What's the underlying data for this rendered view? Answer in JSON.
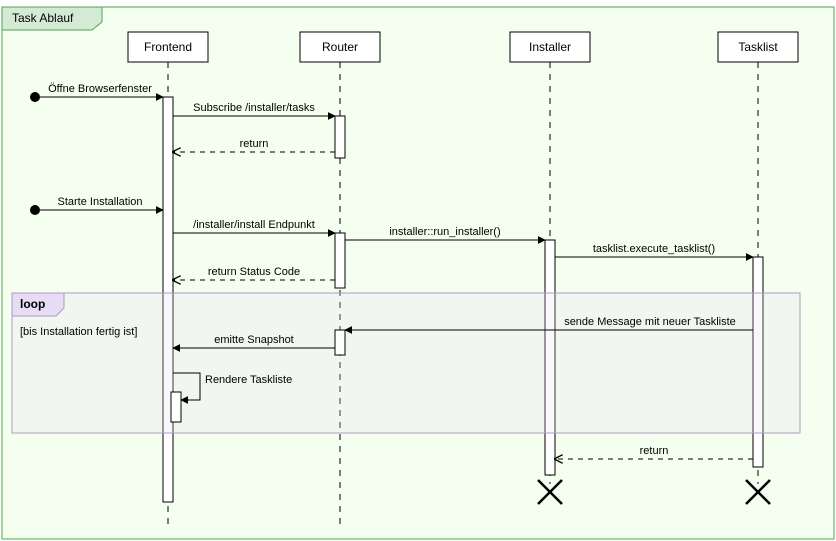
{
  "frame": {
    "title": "Task Ablauf"
  },
  "participants": {
    "p1": "Frontend",
    "p2": "Router",
    "p3": "Installer",
    "p4": "Tasklist"
  },
  "labels": {
    "open_browser": "Öffne Browserfenster",
    "subscribe": "Subscribe /installer/tasks",
    "return1": "return",
    "start_install": "Starte Installation",
    "install_endpoint": "/installer/install Endpunkt",
    "run_installer": "installer::run_installer()",
    "execute_tasklist": "tasklist.execute_tasklist()",
    "return_status": "return Status Code",
    "loop_title": "loop",
    "loop_guard": "[bis Installation fertig ist]",
    "send_msg": "sende Message mit neuer Taskliste",
    "emit_snapshot": "emitte Snapshot",
    "render_tasklist": "Rendere Taskliste",
    "return2": "return"
  }
}
